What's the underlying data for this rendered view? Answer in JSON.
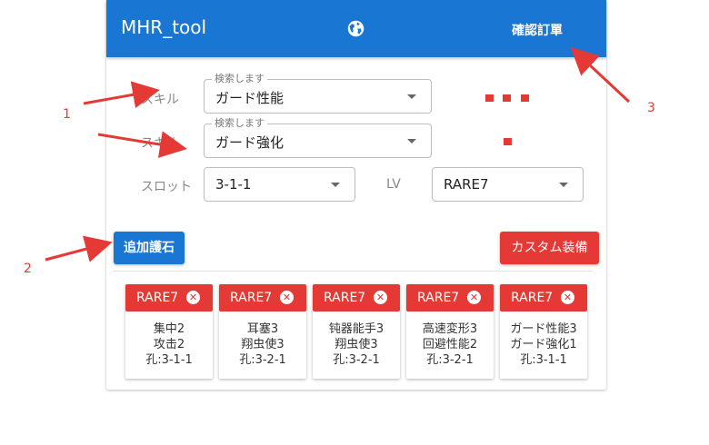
{
  "header": {
    "title": "MHR_tool",
    "order_button": "確認訂單",
    "globe_icon": "globe-icon",
    "color": "#1976d2"
  },
  "form": {
    "skill1": {
      "label": "スキル",
      "legend": "検索します",
      "value": "ガード性能"
    },
    "skill2": {
      "label": "スキル",
      "legend": "検索します",
      "value": "ガード強化"
    },
    "slot": {
      "label": "スロット",
      "value": "3-1-1"
    },
    "lv": {
      "label": "LV",
      "value": "RARE7"
    },
    "skill1_level_dots": 3,
    "skill2_level_dots": 1
  },
  "buttons": {
    "add_talisman": "追加護石",
    "custom_equip": "カスタム装備"
  },
  "talismans": [
    {
      "rarity": "RARE7",
      "line1": "集中2",
      "line2": "攻击2",
      "slot": "孔:3-1-1"
    },
    {
      "rarity": "RARE7",
      "line1": "耳塞3",
      "line2": "翔虫使3",
      "slot": "孔:3-2-1"
    },
    {
      "rarity": "RARE7",
      "line1": "钝器能手3",
      "line2": "翔虫使3",
      "slot": "孔:3-2-1"
    },
    {
      "rarity": "RARE7",
      "line1": "高速変形3",
      "line2": "回避性能2",
      "slot": "孔:3-2-1"
    },
    {
      "rarity": "RARE7",
      "line1": "ガード性能3",
      "line2": "ガード強化1",
      "slot": "孔:3-1-1"
    }
  ],
  "annotations": {
    "a1": "1",
    "a2": "2",
    "a3": "3",
    "color": "#e53935"
  }
}
